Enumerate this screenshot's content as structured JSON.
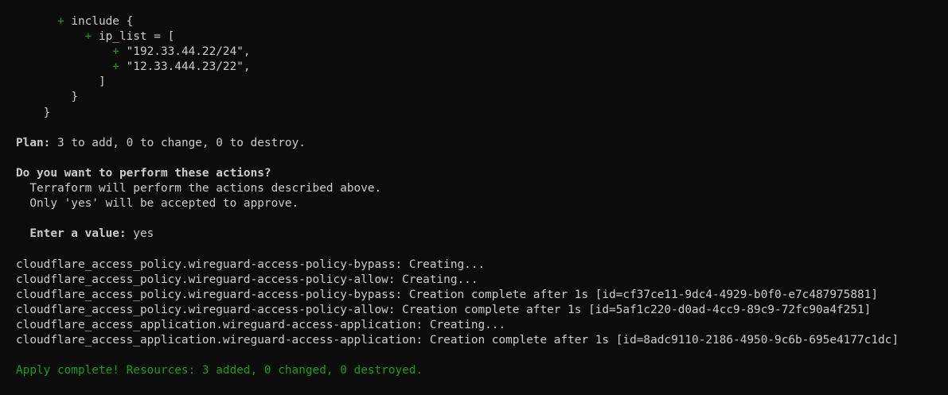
{
  "colors": {
    "background": "#0c0c0c",
    "text": "#cccccc",
    "add_marker": "#13a10e",
    "success": "#13a10e"
  },
  "diff": {
    "marker": "+",
    "include_line": " include {",
    "ip_list_line": " ip_list = [",
    "ip_1": " \"192.33.44.22/24\",",
    "ip_2": " \"12.33.444.23/22\",",
    "close_bracket": "]",
    "close_brace_inner": "}",
    "close_brace_outer": "}"
  },
  "plan": {
    "label": "Plan:",
    "summary": " 3 to add, 0 to change, 0 to destroy."
  },
  "prompt": {
    "question": "Do you want to perform these actions?",
    "line_1": "  Terraform will perform the actions described above.",
    "line_2": "  Only 'yes' will be accepted to approve.",
    "enter_label": "  Enter a value:",
    "enter_value": " yes"
  },
  "log": [
    "cloudflare_access_policy.wireguard-access-policy-bypass: Creating...",
    "cloudflare_access_policy.wireguard-access-policy-allow: Creating...",
    "cloudflare_access_policy.wireguard-access-policy-bypass: Creation complete after 1s [id=cf37ce11-9dc4-4929-b0f0-e7c487975881]",
    "cloudflare_access_policy.wireguard-access-policy-allow: Creation complete after 1s [id=5af1c220-d0ad-4cc9-89c9-72fc90a4f251]",
    "cloudflare_access_application.wireguard-access-application: Creating...",
    "cloudflare_access_application.wireguard-access-application: Creation complete after 1s [id=8adc9110-2186-4950-9c6b-695e4177c1dc]"
  ],
  "apply_result": "Apply complete! Resources: 3 added, 0 changed, 0 destroyed."
}
